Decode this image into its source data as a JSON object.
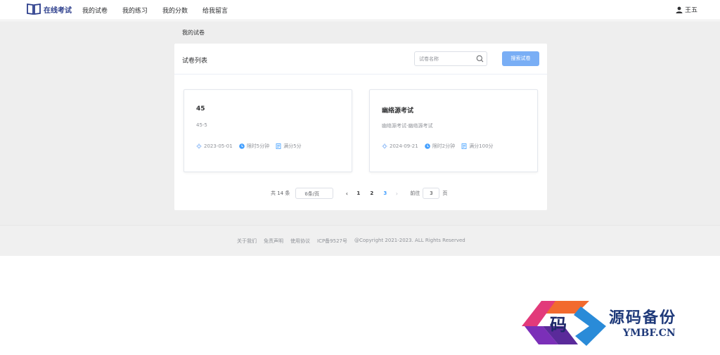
{
  "header": {
    "logo_text": "在线考试",
    "nav": [
      "我的试卷",
      "我的练习",
      "我的分数",
      "给我留言"
    ],
    "user_name": "王五"
  },
  "breadcrumb": "我的试卷",
  "panel": {
    "title": "试卷列表",
    "search_placeholder": "试卷名称",
    "search_button": "搜索试卷"
  },
  "papers": [
    {
      "title": "45",
      "description": "45-5",
      "date": "2023-05-01",
      "time_limit": "限时5分钟",
      "full_score": "满分5分"
    },
    {
      "title": "幽络源考试",
      "description": "幽络源考试-幽络源考试",
      "date": "2024-09-21",
      "time_limit": "限时2分钟",
      "full_score": "满分100分"
    }
  ],
  "pagination": {
    "total": "共 14 条",
    "page_size": "6条/页",
    "pages": [
      "1",
      "2",
      "3"
    ],
    "current_page": "3",
    "goto_label": "前往",
    "goto_value": "3",
    "page_suffix": "页"
  },
  "footer": {
    "links": [
      "关于我们",
      "免责声明",
      "使用协议",
      "ICP备9527号",
      "@Copyright 2021-2023. ALL Rights Reserved"
    ]
  },
  "watermark": {
    "glyph": "码",
    "name": "源码备份",
    "url": "YMBF.CN"
  },
  "colors": {
    "accent": "#409eff",
    "search_button": "#79aef5",
    "logo": "#2c3e8c"
  }
}
